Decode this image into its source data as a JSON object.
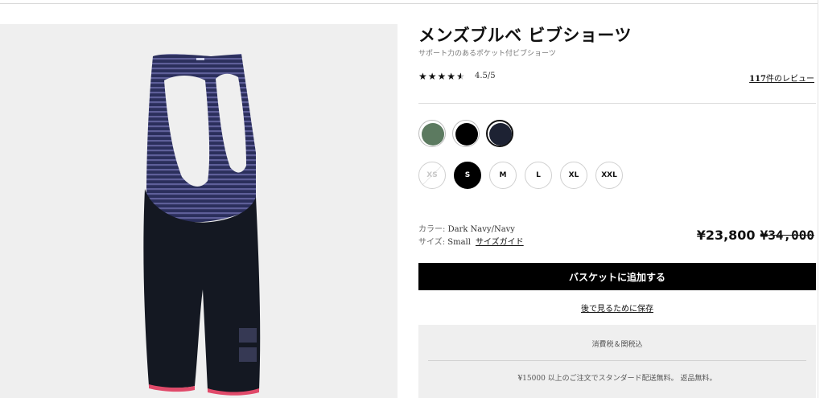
{
  "product": {
    "title": "メンズブルベ ビブショーツ",
    "subtitle": "サポート力のあるポケット付ビブショーツ",
    "rating_text": "4.5/5",
    "rating_value": 4.5,
    "review_count": "117",
    "review_suffix": "件のレビュー"
  },
  "colors": [
    {
      "name": "green",
      "hex": "#5c7a60"
    },
    {
      "name": "black",
      "hex": "#000000"
    },
    {
      "name": "dark-navy",
      "hex": "#1d2233",
      "selected": true
    }
  ],
  "sizes": [
    {
      "label": "XS",
      "state": "disabled"
    },
    {
      "label": "S",
      "state": "selected"
    },
    {
      "label": "M",
      "state": "available"
    },
    {
      "label": "L",
      "state": "available"
    },
    {
      "label": "XL",
      "state": "available"
    },
    {
      "label": "XXL",
      "state": "available"
    }
  ],
  "selection": {
    "color_key": "カラー:",
    "color_value": "Dark Navy/Navy",
    "size_key": "サイズ:",
    "size_value": "Small",
    "size_guide": "サイズガイド"
  },
  "pricing": {
    "sale": "¥23,800",
    "original": "¥34,000"
  },
  "actions": {
    "add_to_basket": "バスケットに追加する",
    "save_for_later": "後で見るために保存"
  },
  "notices": {
    "tax": "消費税＆関税込",
    "shipping": "¥15000 以上のご注文でスタンダード配送無料。 返品無料。"
  }
}
